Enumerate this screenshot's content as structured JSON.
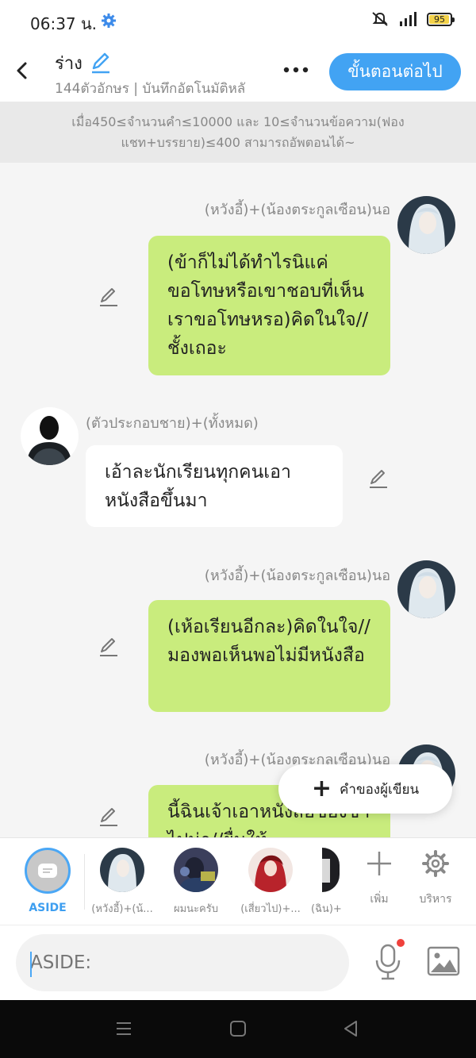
{
  "status_bar": {
    "time": "06:37 น.",
    "battery": "95",
    "battery_level": 0.95
  },
  "header": {
    "title": "ร่าง",
    "subtitle": "144ตัวอักษร | บันทึกอัตโนมัติหลั",
    "next_label": "ขั้นตอนต่อไป"
  },
  "notice": "เมื่อ450≤จำนวนคำ≤10000 และ 10≤จำนวนข้อความ(ฟองแชท+บรรยาย)≤400 สามารถอัพตอนได้~",
  "messages": [
    {
      "side": "right",
      "name": "(หวังอี้)+(น้องตระกูลเซือน)นอ",
      "text": "(ข้าก็ไม่ได้ทำไรนิแค่ขอโทษหรือเขาชอบที่เห็นเราขอโทษหรอ)คิดในใจ//ชั้งเถอะ"
    },
    {
      "side": "left",
      "name": "(ตัวประกอบชาย)+(ทั้งหมด)",
      "text": "เอ้าละนักเรียนทุกคนเอาหนังสือขึ้นมา"
    },
    {
      "side": "right",
      "name": "(หวังอี้)+(น้องตระกูลเซือน)นอ",
      "text": "(เห้อเรียนอีกละ)คิดในใจ//มองพอเห็นพอไม่มีหนังสือ"
    },
    {
      "side": "right",
      "name": "(หวังอี้)+(น้องตระกลเซือน)นอ",
      "text": "นี้ฉินเจ้าเอาหนังสือของข้าไปน่า//ยื่นให้"
    }
  ],
  "author_note_label": "คำของผู้เขียน",
  "characters": [
    {
      "label": "ASIDE",
      "icon": "aside-icon"
    },
    {
      "label": "(หวังอี้)+(น้...",
      "icon": "avatar-white-hair"
    },
    {
      "label": "ผมนะครับ",
      "icon": "avatar-headphones"
    },
    {
      "label": "(เสี่ยวไป)+...",
      "icon": "avatar-red"
    },
    {
      "label": "(ฉิน)+",
      "icon": "avatar-dark"
    }
  ],
  "controls": {
    "add_label": "เพิ่ม",
    "manage_label": "บริหาร"
  },
  "input": {
    "placeholder": "ASIDE:"
  },
  "colors": {
    "accent": "#42a3f3",
    "bubble_green": "#c9ec7d",
    "bubble_white": "#ffffff",
    "mic_dot": "#f0413c"
  }
}
